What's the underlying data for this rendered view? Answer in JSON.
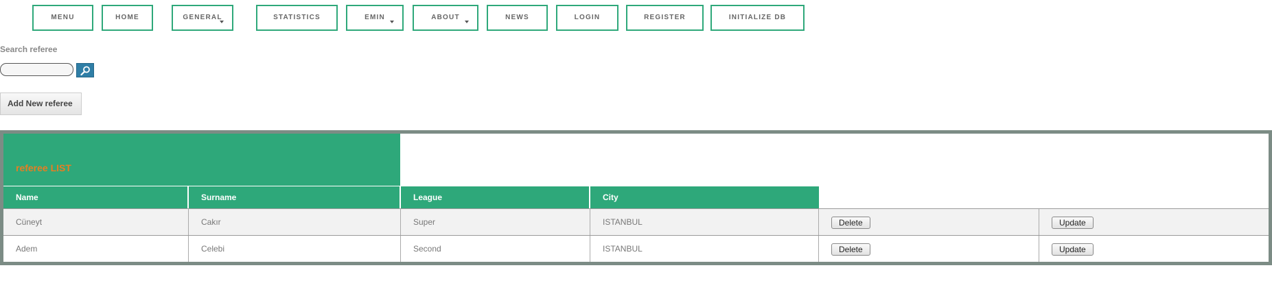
{
  "nav": {
    "items": [
      {
        "label": "MENU"
      },
      {
        "label": "HOME"
      },
      {
        "label": "GENERAL",
        "dropdown": true
      },
      {
        "label": "STATISTICS"
      },
      {
        "label": "EMIN",
        "dropdown": true
      },
      {
        "label": "ABOUT",
        "dropdown": true
      },
      {
        "label": "NEWS"
      },
      {
        "label": "LOGIN"
      },
      {
        "label": "REGISTER"
      },
      {
        "label": "INITIALIZE DB"
      }
    ]
  },
  "search": {
    "label": "Search referee",
    "value": "",
    "button_icon": "search-icon"
  },
  "actions": {
    "add_label": "Add New referee"
  },
  "table": {
    "caption": "referee LIST",
    "columns": [
      "Name",
      "Surname",
      "League",
      "City"
    ],
    "rows": [
      {
        "name": "Cüneyt",
        "surname": "Cakır",
        "league": "Super",
        "city": "ISTANBUL",
        "delete": "Delete",
        "update": "Update"
      },
      {
        "name": "Adem",
        "surname": "Celebi",
        "league": "Second",
        "city": "ISTANBUL",
        "delete": "Delete",
        "update": "Update"
      }
    ]
  },
  "colors": {
    "accent": "#2ea87a",
    "caption": "#e67e22",
    "frame": "#7c8c85",
    "search_button": "#2f7ea6"
  }
}
